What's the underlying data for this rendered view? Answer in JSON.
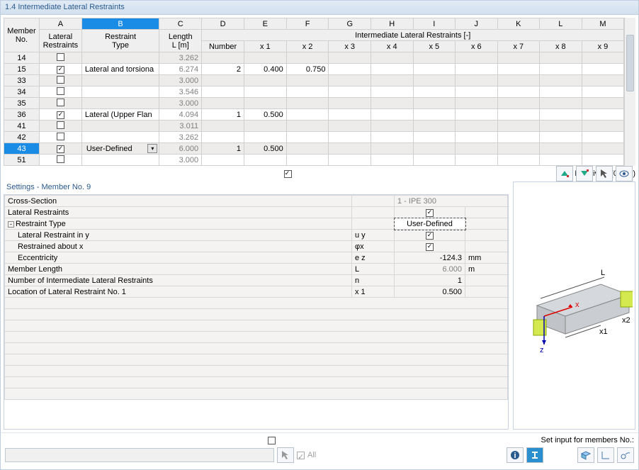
{
  "title": "1.4 Intermediate Lateral Restraints",
  "columns": {
    "rowhead": [
      "Member",
      "No."
    ],
    "A": "A",
    "A_sub": [
      "Lateral",
      "Restraints"
    ],
    "B": "B",
    "B_sub": [
      "Restraint",
      "Type"
    ],
    "C": "C",
    "C_sub": [
      "Length",
      "L [m]"
    ],
    "group": "Intermediate Lateral Restraints [-]",
    "D": "D",
    "D_sub": "Number",
    "E": "E",
    "E_sub": "x 1",
    "F": "F",
    "F_sub": "x 2",
    "G": "G",
    "G_sub": "x 3",
    "H": "H",
    "H_sub": "x 4",
    "I": "I",
    "I_sub": "x 5",
    "J": "J",
    "J_sub": "x 6",
    "K": "K",
    "K_sub": "x 7",
    "L": "L",
    "L_sub": "x 8",
    "M": "M",
    "M_sub": "x 9"
  },
  "rows": [
    {
      "no": "14",
      "chk": false,
      "type": "",
      "len": "3.262",
      "num": "",
      "x1": "",
      "x2": ""
    },
    {
      "no": "15",
      "chk": true,
      "type": "Lateral and torsiona",
      "len": "6.274",
      "num": "2",
      "x1": "0.400",
      "x2": "0.750"
    },
    {
      "no": "33",
      "chk": false,
      "type": "",
      "len": "3.000",
      "num": "",
      "x1": "",
      "x2": ""
    },
    {
      "no": "34",
      "chk": false,
      "type": "",
      "len": "3.546",
      "num": "",
      "x1": "",
      "x2": ""
    },
    {
      "no": "35",
      "chk": false,
      "type": "",
      "len": "3.000",
      "num": "",
      "x1": "",
      "x2": ""
    },
    {
      "no": "36",
      "chk": true,
      "type": "Lateral (Upper Flan",
      "len": "4.094",
      "num": "1",
      "x1": "0.500",
      "x2": ""
    },
    {
      "no": "41",
      "chk": false,
      "type": "",
      "len": "3.011",
      "num": "",
      "x1": "",
      "x2": ""
    },
    {
      "no": "42",
      "chk": false,
      "type": "",
      "len": "3.262",
      "num": "",
      "x1": "",
      "x2": ""
    },
    {
      "no": "43",
      "chk": true,
      "type": "User-Defined",
      "len": "6.000",
      "num": "1",
      "x1": "0.500",
      "x2": "",
      "selected": true,
      "dropdown": true
    },
    {
      "no": "51",
      "chk": false,
      "type": "",
      "len": "3.000",
      "num": "",
      "x1": "",
      "x2": ""
    }
  ],
  "relatively": {
    "checked": true,
    "label": "Relatively (0 ... 1)"
  },
  "settings": {
    "title": "Settings - Member No. 9",
    "rows": {
      "cross_section": {
        "label": "Cross-Section",
        "value": "1 - IPE 300"
      },
      "lateral_restraints": {
        "label": "Lateral Restraints",
        "checked": true
      },
      "restraint_type": {
        "label": "Restraint Type",
        "value": "User-Defined"
      },
      "lat_y": {
        "label": "Lateral Restraint in y",
        "sym": "u y",
        "checked": true
      },
      "rest_x": {
        "label": "Restrained about x",
        "sym": "φx",
        "checked": true
      },
      "ecc": {
        "label": "Eccentricity",
        "sym": "e z",
        "value": "-124.3",
        "unit": "mm"
      },
      "memlen": {
        "label": "Member Length",
        "sym": "L",
        "value": "6.000",
        "unit": "m"
      },
      "numilr": {
        "label": "Number of Intermediate Lateral Restraints",
        "sym": "n",
        "value": "1"
      },
      "loc1": {
        "label": "Location of Lateral Restraint No. 1",
        "sym": "x 1",
        "value": "0.500"
      }
    }
  },
  "bottom": {
    "set_input": "Set input for members No.:",
    "all": "All"
  },
  "preview": {
    "x": "x",
    "z": "z",
    "L": "L",
    "x1": "x1",
    "x2": "x2"
  }
}
